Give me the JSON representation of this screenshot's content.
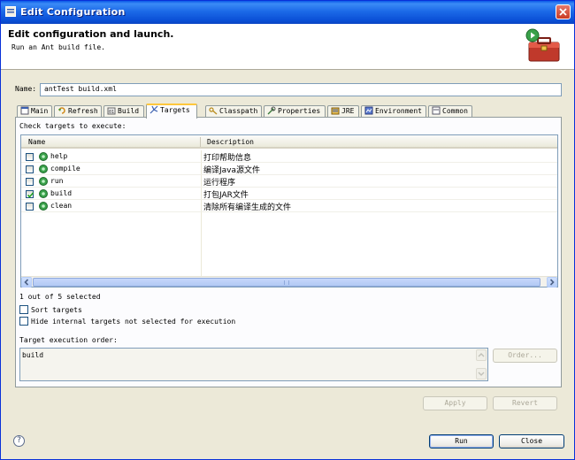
{
  "window": {
    "title": "Edit Configuration"
  },
  "banner": {
    "heading": "Edit configuration and launch.",
    "subtitle": "Run an Ant build file."
  },
  "name_field": {
    "label": "Name:",
    "value": "antTest build.xml"
  },
  "tabs": [
    {
      "label": "Main",
      "icon": "main-icon"
    },
    {
      "label": "Refresh",
      "icon": "refresh-icon"
    },
    {
      "label": "Build",
      "icon": "build-icon"
    },
    {
      "label": "Targets",
      "icon": "targets-icon",
      "active": true
    },
    {
      "label": "Classpath",
      "icon": "classpath-icon"
    },
    {
      "label": "Properties",
      "icon": "properties-icon"
    },
    {
      "label": "JRE",
      "icon": "jre-icon"
    },
    {
      "label": "Environment",
      "icon": "environment-icon"
    },
    {
      "label": "Common",
      "icon": "common-icon"
    }
  ],
  "targets_panel": {
    "instruction": "Check targets to execute:",
    "columns": [
      "Name",
      "Description"
    ],
    "rows": [
      {
        "name": "help",
        "description": "打印帮助信息",
        "checked": false
      },
      {
        "name": "compile",
        "description": "编译Java源文件",
        "checked": false
      },
      {
        "name": "run",
        "description": "运行程序",
        "checked": false
      },
      {
        "name": "build",
        "description": "打包JAR文件",
        "checked": true
      },
      {
        "name": "clean",
        "description": "清除所有编译生成的文件",
        "checked": false
      }
    ],
    "selection_status": "1 out of 5 selected",
    "sort_targets_label": "Sort targets",
    "hide_internal_label": "Hide internal targets not selected for execution",
    "order_label": "Target execution order:",
    "order_value": "build",
    "order_button": "Order..."
  },
  "buttons": {
    "apply": "Apply",
    "revert": "Revert",
    "run": "Run",
    "close": "Close"
  },
  "colors": {
    "titlebar": "#0a58e8",
    "dialog_bg": "#ece9d8",
    "active_tab_accent": "#ffc73c",
    "target_icon": "#2e9a3e"
  }
}
